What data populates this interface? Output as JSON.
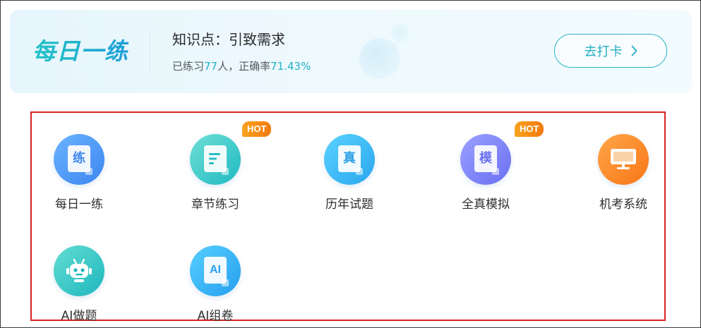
{
  "banner": {
    "brand": "每日一练",
    "knowledge_point": "知识点：引致需求",
    "stats_prefix": "已练习",
    "practiced_count": "77",
    "stats_middle": "人，正确率",
    "accuracy": "71.43%",
    "checkin_label": "去打卡"
  },
  "grid": {
    "hot_badge": "HOT",
    "items": [
      {
        "label": "每日一练",
        "icon": "practice-doc-icon",
        "glyph": "练",
        "hot": false
      },
      {
        "label": "章节练习",
        "icon": "chapter-doc-icon",
        "glyph": "",
        "hot": true
      },
      {
        "label": "历年试题",
        "icon": "exam-doc-icon",
        "glyph": "真",
        "hot": false
      },
      {
        "label": "全真模拟",
        "icon": "mock-doc-icon",
        "glyph": "模",
        "hot": true
      },
      {
        "label": "机考系统",
        "icon": "computer-monitor-icon",
        "glyph": "",
        "hot": false
      },
      {
        "label": "AI做题",
        "icon": "robot-icon",
        "glyph": "",
        "hot": false
      },
      {
        "label": "AI组卷",
        "icon": "ai-doc-icon",
        "glyph": "AI",
        "hot": false
      }
    ]
  },
  "colors": {
    "accent": "#21b1c4",
    "highlight_border": "#d62323",
    "hot_badge": "#f5901a"
  }
}
